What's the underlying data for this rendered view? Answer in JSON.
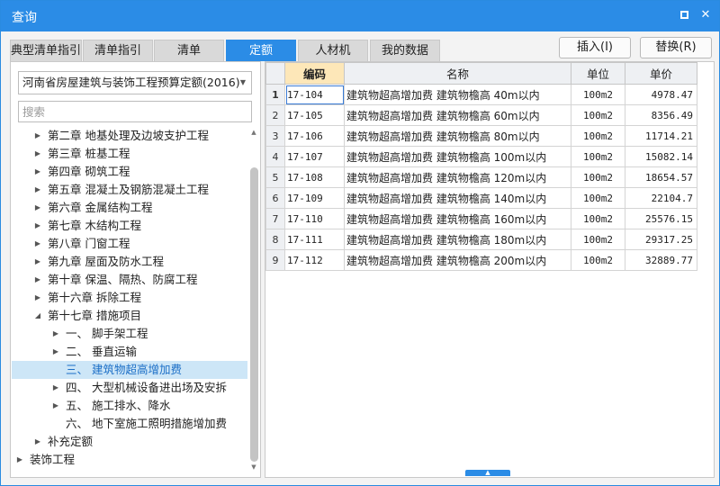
{
  "window": {
    "title": "查询",
    "accent_color": "#2b8ce6",
    "maximize_icon": "maximize-icon",
    "close_icon": "close-icon",
    "close_glyph": "✕"
  },
  "tabs": [
    {
      "label": "典型清单指引",
      "active": false
    },
    {
      "label": "清单指引",
      "active": false
    },
    {
      "label": "清单",
      "active": false
    },
    {
      "label": "定额",
      "active": true
    },
    {
      "label": "人材机",
      "active": false
    },
    {
      "label": "我的数据",
      "active": false
    }
  ],
  "actions": {
    "insert_label": "插入(I)",
    "replace_label": "替换(R)"
  },
  "library": {
    "selected": "河南省房屋建筑与装饰工程预算定额(2016)"
  },
  "search": {
    "placeholder": "搜索",
    "value": ""
  },
  "tree": [
    {
      "label": "第二章 地基处理及边坡支护工程",
      "level": 1,
      "expand": "collapsed",
      "selected": false
    },
    {
      "label": "第三章 桩基工程",
      "level": 1,
      "expand": "collapsed",
      "selected": false
    },
    {
      "label": "第四章 砌筑工程",
      "level": 1,
      "expand": "collapsed",
      "selected": false
    },
    {
      "label": "第五章 混凝土及钢筋混凝土工程",
      "level": 1,
      "expand": "collapsed",
      "selected": false
    },
    {
      "label": "第六章 金属结构工程",
      "level": 1,
      "expand": "collapsed",
      "selected": false
    },
    {
      "label": "第七章 木结构工程",
      "level": 1,
      "expand": "collapsed",
      "selected": false
    },
    {
      "label": "第八章 门窗工程",
      "level": 1,
      "expand": "collapsed",
      "selected": false
    },
    {
      "label": "第九章 屋面及防水工程",
      "level": 1,
      "expand": "collapsed",
      "selected": false
    },
    {
      "label": "第十章 保温、隔热、防腐工程",
      "level": 1,
      "expand": "collapsed",
      "selected": false
    },
    {
      "label": "第十六章 拆除工程",
      "level": 1,
      "expand": "collapsed",
      "selected": false
    },
    {
      "label": "第十七章 措施项目",
      "level": 1,
      "expand": "expanded",
      "selected": false
    },
    {
      "label": "一、 脚手架工程",
      "level": 2,
      "expand": "collapsed",
      "selected": false
    },
    {
      "label": "二、 垂直运输",
      "level": 2,
      "expand": "collapsed",
      "selected": false
    },
    {
      "label": "三、 建筑物超高增加费",
      "level": 2,
      "expand": "none",
      "selected": true
    },
    {
      "label": "四、 大型机械设备进出场及安拆",
      "level": 2,
      "expand": "collapsed",
      "selected": false
    },
    {
      "label": "五、 施工排水、降水",
      "level": 2,
      "expand": "collapsed",
      "selected": false
    },
    {
      "label": "六、 地下室施工照明措施增加费",
      "level": 2,
      "expand": "none",
      "selected": false
    },
    {
      "label": "补充定额",
      "level": 1,
      "expand": "collapsed",
      "selected": false
    },
    {
      "label": "装饰工程",
      "level": 0,
      "expand": "collapsed",
      "selected": false
    }
  ],
  "grid": {
    "columns": [
      "编码",
      "名称",
      "单位",
      "单价"
    ],
    "active_column": "编码",
    "current_row": 1,
    "rows": [
      {
        "num": "1",
        "code": "17-104",
        "name": "建筑物超高增加费 建筑物檐高 40m以内",
        "unit": "100m2",
        "price": "4978.47"
      },
      {
        "num": "2",
        "code": "17-105",
        "name": "建筑物超高增加费 建筑物檐高 60m以内",
        "unit": "100m2",
        "price": "8356.49"
      },
      {
        "num": "3",
        "code": "17-106",
        "name": "建筑物超高增加费 建筑物檐高 80m以内",
        "unit": "100m2",
        "price": "11714.21"
      },
      {
        "num": "4",
        "code": "17-107",
        "name": "建筑物超高增加费 建筑物檐高 100m以内",
        "unit": "100m2",
        "price": "15082.14"
      },
      {
        "num": "5",
        "code": "17-108",
        "name": "建筑物超高增加费 建筑物檐高 120m以内",
        "unit": "100m2",
        "price": "18654.57"
      },
      {
        "num": "6",
        "code": "17-109",
        "name": "建筑物超高增加费 建筑物檐高 140m以内",
        "unit": "100m2",
        "price": "22104.7"
      },
      {
        "num": "7",
        "code": "17-110",
        "name": "建筑物超高增加费 建筑物檐高 160m以内",
        "unit": "100m2",
        "price": "25576.15"
      },
      {
        "num": "8",
        "code": "17-111",
        "name": "建筑物超高增加费 建筑物檐高 180m以内",
        "unit": "100m2",
        "price": "29317.25"
      },
      {
        "num": "9",
        "code": "17-112",
        "name": "建筑物超高增加费 建筑物檐高 200m以内",
        "unit": "100m2",
        "price": "32889.77"
      }
    ]
  }
}
